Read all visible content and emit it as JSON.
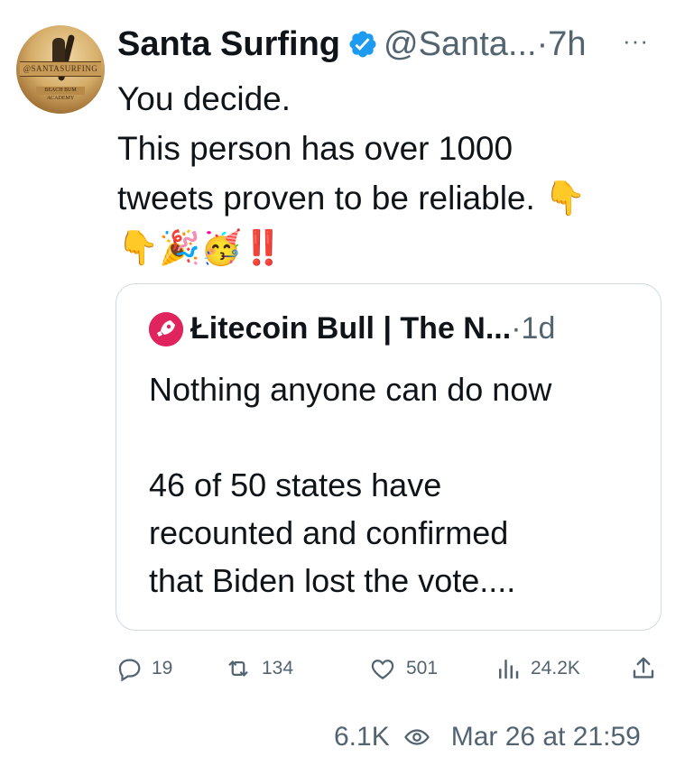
{
  "author": {
    "name": "Santa Surfing",
    "handle": "@Santa...",
    "time_sep": "·",
    "time": "7h",
    "more_icon": "more-icon",
    "avatar_text": "@SANTASURFING",
    "avatar_subtext": "BEACH BUM ACADEMY"
  },
  "tweet": {
    "lines": [
      "You decide.",
      "This person has over 1000",
      "tweets proven to be reliable. 👇"
    ],
    "emoji_line": "👇🎉🥳‼️"
  },
  "quote": {
    "name": "Łitecoin Bull | The N...",
    "time_sep": "·",
    "time": "1d",
    "lines": [
      "Nothing anyone can do now",
      "",
      "46 of 50 states have",
      "recounted and confirmed",
      "that Biden lost the vote...."
    ]
  },
  "actions": {
    "replies": "19",
    "retweets": "134",
    "likes": "501",
    "views": "24.2K"
  },
  "footer": {
    "views": "6.1K",
    "datetime": "Mar 26 at 21:59"
  },
  "colors": {
    "text": "#0f1419",
    "muted": "#536471",
    "verified": "#1d9bf0",
    "border": "#cfd9de"
  }
}
